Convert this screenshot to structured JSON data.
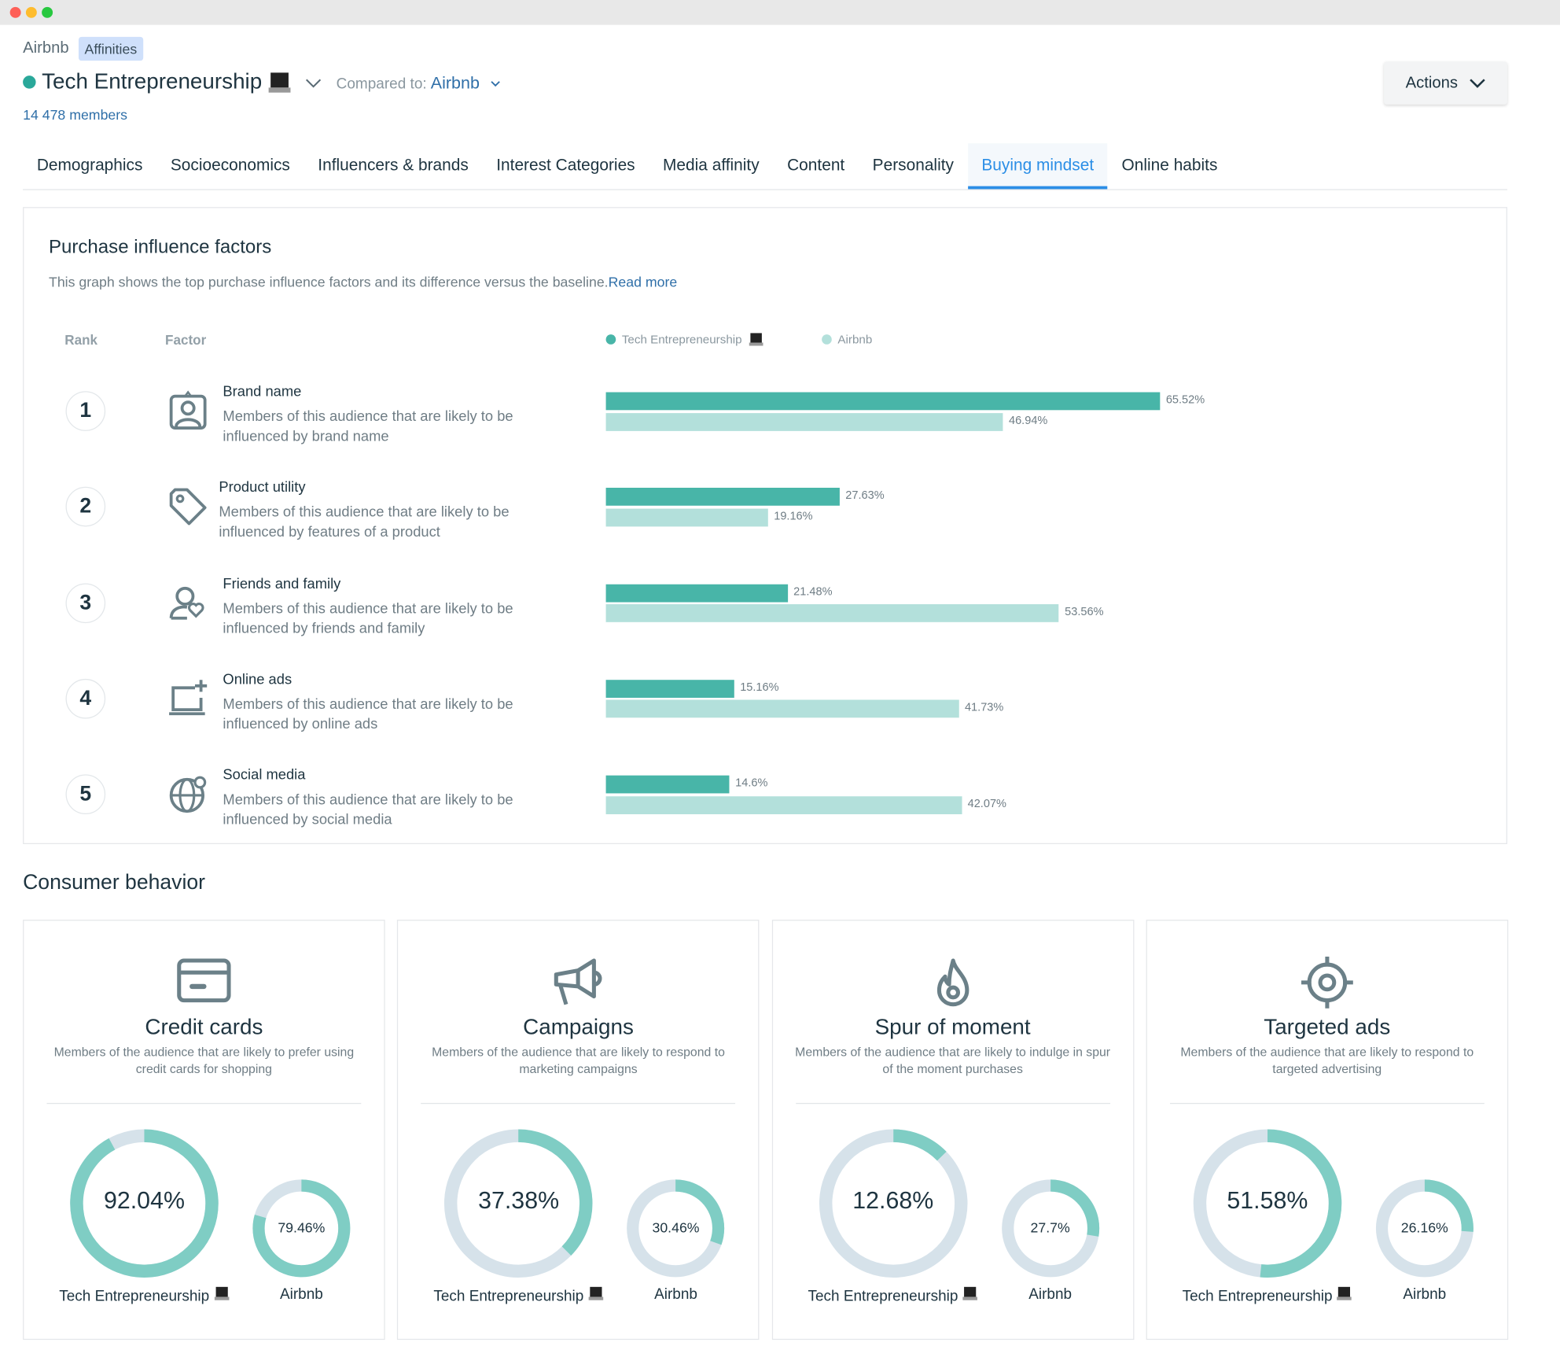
{
  "header": {
    "brand": "Airbnb",
    "badge": "Affinities",
    "audience": "Tech Entrepreneurship",
    "compared_label": "Compared to:",
    "compared_value": "Airbnb",
    "members": "14 478 members",
    "actions_label": "Actions"
  },
  "tabs": [
    {
      "label": "Demographics"
    },
    {
      "label": "Socioeconomics"
    },
    {
      "label": "Influencers & brands"
    },
    {
      "label": "Interest Categories"
    },
    {
      "label": "Media affinity"
    },
    {
      "label": "Content"
    },
    {
      "label": "Personality"
    },
    {
      "label": "Buying mindset",
      "active": true
    },
    {
      "label": "Online habits"
    }
  ],
  "purchase": {
    "title": "Purchase influence factors",
    "description": "This graph shows the top purchase influence factors and its difference versus the baseline.",
    "read_more": "Read more",
    "rank_header": "Rank",
    "factor_header": "Factor",
    "legend": [
      "Tech Entrepreneurship",
      "Airbnb"
    ],
    "colors": {
      "audience": "#48b5a8",
      "baseline": "#b3e0db"
    }
  },
  "chart_data": {
    "type": "bar",
    "orientation": "horizontal",
    "categories": [
      "Brand name",
      "Product utility",
      "Friends and family",
      "Online ads",
      "Social media"
    ],
    "series": [
      {
        "name": "Tech Entrepreneurship",
        "values": [
          65.52,
          27.63,
          21.48,
          15.16,
          14.6
        ],
        "labels": [
          "65.52%",
          "27.63%",
          "21.48%",
          "15.16%",
          "14.6%"
        ]
      },
      {
        "name": "Airbnb",
        "values": [
          46.94,
          19.16,
          53.56,
          41.73,
          42.07
        ],
        "labels": [
          "46.94%",
          "19.16%",
          "53.56%",
          "41.73%",
          "42.07%"
        ]
      }
    ],
    "factors": [
      {
        "rank": "1",
        "icon": "id-badge-icon",
        "title": "Brand name",
        "desc": "Members of this audience that are likely to be influenced by brand name"
      },
      {
        "rank": "2",
        "icon": "tag-icon",
        "title": "Product utility",
        "desc": "Members of this audience that are likely to be influenced by features of a product"
      },
      {
        "rank": "3",
        "icon": "user-heart-icon",
        "title": "Friends and family",
        "desc": "Members of this audience that are likely to be influenced by friends and family"
      },
      {
        "rank": "4",
        "icon": "screen-plus-icon",
        "title": "Online ads",
        "desc": "Members of this audience that are likely to be influenced by online ads"
      },
      {
        "rank": "5",
        "icon": "globe-icon",
        "title": "Social media",
        "desc": "Members of this audience that are likely to be influenced by social media"
      }
    ]
  },
  "consumer": {
    "title": "Consumer behavior",
    "colors": {
      "fill": "#7fcdc4",
      "track": "#d6e2ea"
    },
    "cards": [
      {
        "icon": "credit-card-icon",
        "title": "Credit cards",
        "desc": "Members of the audience that are likely to prefer using credit cards for shopping",
        "audience_value": 92.04,
        "audience_label": "92.04%",
        "baseline_value": 79.46,
        "baseline_label": "79.46%",
        "audience_name": "Tech Entrepreneurship",
        "baseline_name": "Airbnb"
      },
      {
        "icon": "megaphone-icon",
        "title": "Campaigns",
        "desc": "Members of the audience that are likely to respond to marketing campaigns",
        "audience_value": 37.38,
        "audience_label": "37.38%",
        "baseline_value": 30.46,
        "baseline_label": "30.46%",
        "audience_name": "Tech Entrepreneurship",
        "baseline_name": "Airbnb"
      },
      {
        "icon": "flame-icon",
        "title": "Spur of moment",
        "desc": "Members of the audience that are likely to indulge in spur of the moment purchases",
        "audience_value": 12.68,
        "audience_label": "12.68%",
        "baseline_value": 27.7,
        "baseline_label": "27.7%",
        "audience_name": "Tech Entrepreneurship",
        "baseline_name": "Airbnb"
      },
      {
        "icon": "target-icon",
        "title": "Targeted ads",
        "desc": "Members of the audience that are likely to respond to targeted advertising",
        "audience_value": 51.58,
        "audience_label": "51.58%",
        "baseline_value": 26.16,
        "baseline_label": "26.16%",
        "audience_name": "Tech Entrepreneurship",
        "baseline_name": "Airbnb"
      }
    ]
  }
}
